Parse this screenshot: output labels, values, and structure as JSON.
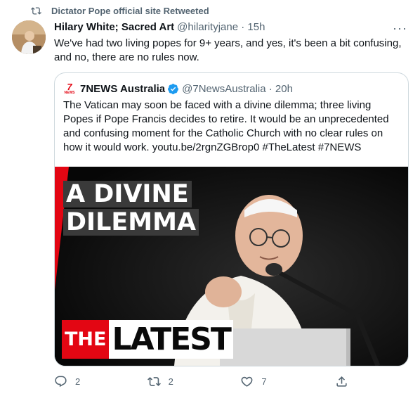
{
  "retweet": {
    "label": "Dictator Pope official site Retweeted"
  },
  "tweet": {
    "author_name": "Hilary White; Sacred Art",
    "handle_time": "@hilarityjane · 15h",
    "text": "We've had two living popes for 9+ years, and yes, it's been a bit confusing, and no, there are no rules now."
  },
  "quote": {
    "author_name": "7NEWS Australia",
    "handle_time": "@7NewsAustralia · 20h",
    "text": "The Vatican may soon be faced with a divine dilemma; three living Popes if Pope Francis decides to retire. It would be an unprecedented and confusing moment for the Catholic Church with no clear rules on how it would work. youtu.be/2rgnZGBrop0 #TheLatest #7NEWS",
    "logo_number": "7",
    "logo_word": "NEWS",
    "media": {
      "headline_line1": "A DIVINE",
      "headline_line2": "DILEMMA",
      "badge_the": "THE",
      "badge_latest": "LATEST"
    }
  },
  "actions": {
    "replies": "2",
    "retweets": "2",
    "likes": "7"
  },
  "colors": {
    "muted": "#536471",
    "verified": "#1d9bf0",
    "brand_red": "#e30613"
  }
}
